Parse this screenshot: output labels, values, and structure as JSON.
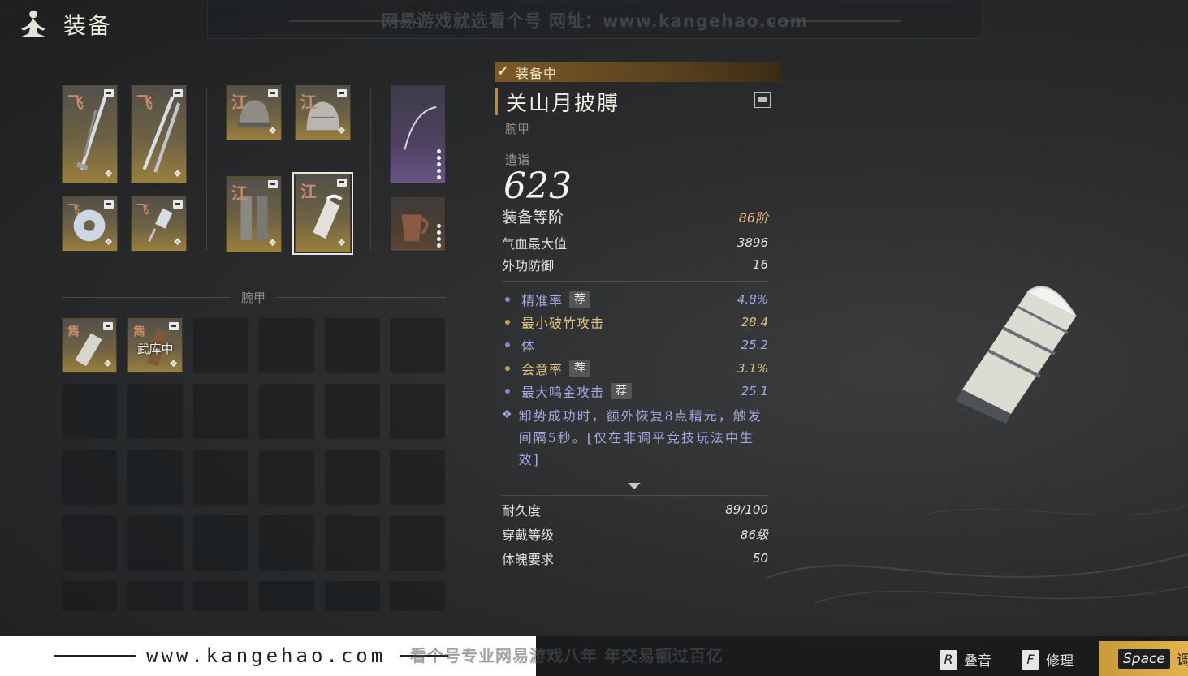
{
  "header": {
    "title": "装备",
    "watermark": "网易游戏就选看个号   网址：www.kangehao.com"
  },
  "equipped": {
    "weapons": [
      {
        "tag": "飞"
      },
      {
        "tag": "飞"
      },
      {
        "tag": "飞"
      },
      {
        "tag": "飞"
      }
    ],
    "armor": [
      {
        "tag": "江"
      },
      {
        "tag": "江"
      },
      {
        "tag": "江"
      },
      {
        "tag": "江"
      }
    ]
  },
  "inventory": {
    "section_label": "腕甲",
    "items": [
      {
        "tag": "雋",
        "caption": ""
      },
      {
        "tag": "雋",
        "caption": "武库中"
      }
    ]
  },
  "detail": {
    "equipped_label": "装备中",
    "name": "关山月披膊",
    "type": "腕甲",
    "score_label": "造诣",
    "score": "623",
    "tier_label": "装备等阶",
    "tier_value": "86阶",
    "base_stats": [
      {
        "label": "气血最大值",
        "value": "3896"
      },
      {
        "label": "外功防御",
        "value": "16"
      }
    ],
    "affixes": [
      {
        "label": "精准率",
        "recommended": "荐",
        "value": "4.8%",
        "color": "blue"
      },
      {
        "label": "最小破竹攻击",
        "recommended": "",
        "value": "28.4",
        "color": "gold"
      },
      {
        "label": "体",
        "recommended": "",
        "value": "25.2",
        "color": "blue"
      },
      {
        "label": "会意率",
        "recommended": "荐",
        "value": "3.1%",
        "color": "gold"
      },
      {
        "label": "最大鸣金攻击",
        "recommended": "荐",
        "value": "25.1",
        "color": "blue"
      }
    ],
    "effect": "卸势成功时，额外恢复8点精元，触发间隔5秒。[仅在非调平竞技玩法中生效]",
    "footer_stats": [
      {
        "label": "耐久度",
        "value": "89/100"
      },
      {
        "label": "穿戴等级",
        "value": "86级"
      },
      {
        "label": "体魄要求",
        "value": "50"
      }
    ]
  },
  "bottom": {
    "site": "www.kangehao.com",
    "watermark": "看个号专业网易游戏八年  年交易额过百亿",
    "keys": [
      {
        "key": "R",
        "label": "叠音"
      },
      {
        "key": "F",
        "label": "修理"
      }
    ],
    "space": {
      "key": "Space",
      "label": "调"
    }
  },
  "colors": {
    "accent_gold": "#b88a4a",
    "affix_blue": "#a9a6e0",
    "affix_gold": "#e2c484",
    "tier": "#e8b47a"
  }
}
